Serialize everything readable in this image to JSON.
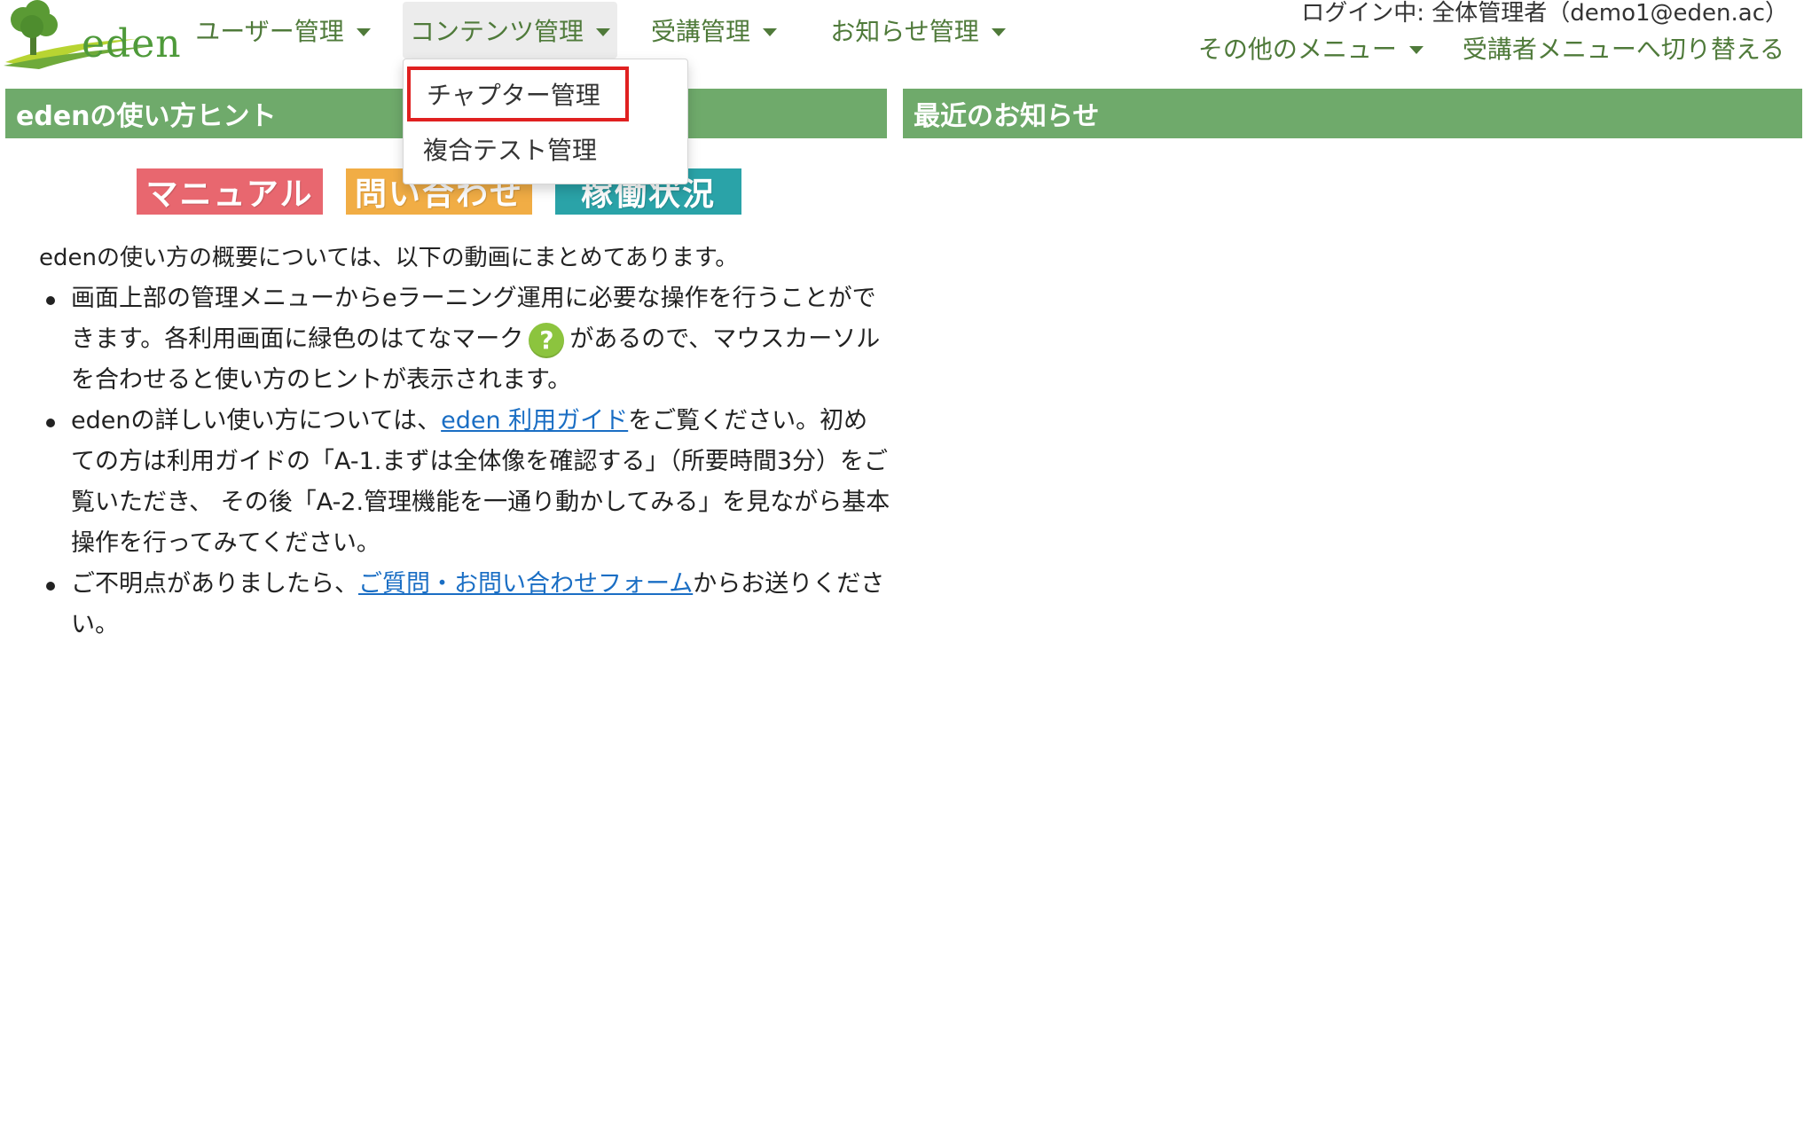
{
  "header": {
    "logo_text": "eden",
    "nav": [
      {
        "label": "ユーザー管理"
      },
      {
        "label": "コンテンツ管理"
      },
      {
        "label": "受講管理"
      },
      {
        "label": "お知らせ管理"
      }
    ],
    "login_status": "ログイン中: 全体管理者（demo1@eden.ac）",
    "other_menu": "その他のメニュー",
    "switch_menu": "受講者メニューへ切り替える"
  },
  "dropdown": {
    "items": [
      {
        "label": "チャプター管理"
      },
      {
        "label": "複合テスト管理"
      }
    ]
  },
  "left_panel": {
    "title": "edenの使い方ヒント",
    "banners": [
      {
        "label": "マニュアル",
        "color": "#e8676f"
      },
      {
        "label": "問い合わせ",
        "color": "#f1ad45"
      },
      {
        "label": "稼働状況",
        "color": "#2aa3a8"
      }
    ],
    "intro": "edenの使い方の概要については、以下の動画にまとめてあります。",
    "hints": [
      {
        "before": "画面上部の管理メニューからeラーニング運用に必要な操作を行うことができます。各利用画面に緑色のはてなマーク",
        "icon": "question-mark-icon",
        "after": "があるので、マウスカーソルを合わせると使い方のヒントが表示されます。"
      },
      {
        "before": "edenの詳しい使い方については、",
        "link": "eden 利用ガイド",
        "after": "をご覧ください。初めての方は利用ガイドの「A-1.まずは全体像を確認する」（所要時間3分）をご覧いただき、 その後「A-2.管理機能を一通り動かしてみる」を見ながら基本操作を行ってみてください。"
      },
      {
        "before": "ご不明点がありましたら、",
        "link": "ご質問・お問い合わせフォーム",
        "after": "からお送りください。"
      }
    ]
  },
  "right_panel": {
    "title": "最近のお知らせ"
  },
  "colors": {
    "brand_green": "#6faa6b",
    "nav_text": "#4f7a3a",
    "link": "#1a6ec4",
    "highlight": "#e02020"
  }
}
